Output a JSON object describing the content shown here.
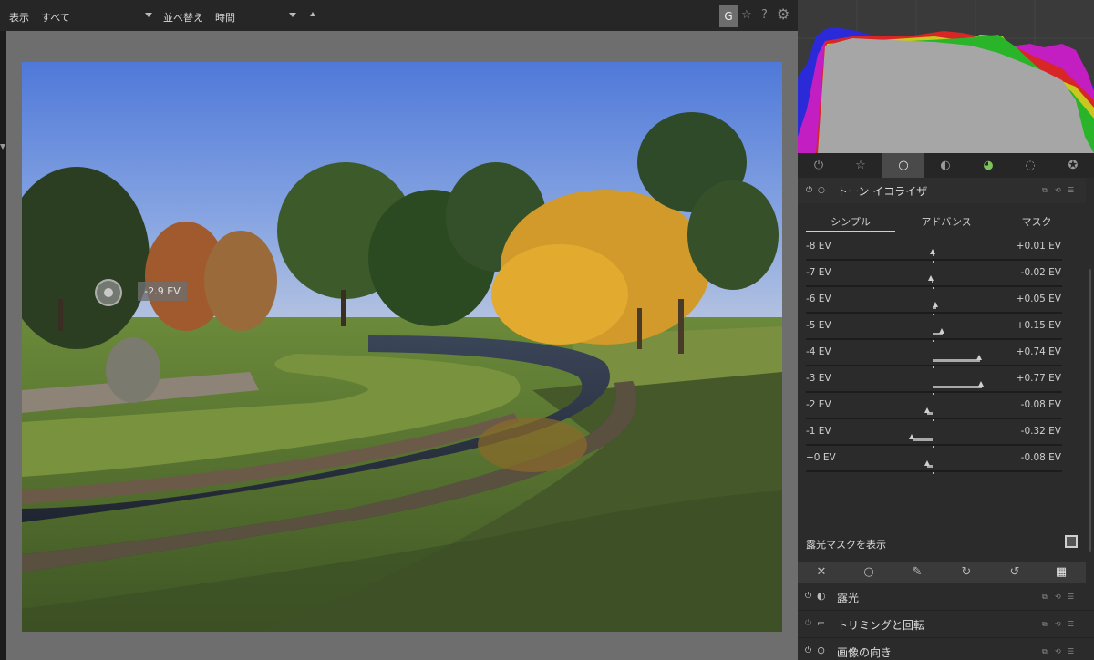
{
  "topbar": {
    "view_label": "表示",
    "view_value": "すべて",
    "sort_label": "並べ替え",
    "sort_value": "時間",
    "g_button": "G",
    "star_icon": "☆",
    "help_icon": "?",
    "settings_icon": "⚙"
  },
  "picker": {
    "readout": "-2.9 EV"
  },
  "module_tabs": [
    "⏻",
    "☆",
    "○",
    "◐",
    "◕",
    "◌",
    "✪"
  ],
  "module": {
    "title": "トーン イコライザ",
    "subtabs": [
      "シンプル",
      "アドバンス",
      "マスク"
    ],
    "active_subtab": 0,
    "sliders": [
      {
        "name": "-8 EV",
        "value": "+0.01 EV",
        "ev": 0.01
      },
      {
        "name": "-7 EV",
        "value": "-0.02 EV",
        "ev": -0.02
      },
      {
        "name": "-6 EV",
        "value": "+0.05 EV",
        "ev": 0.05
      },
      {
        "name": "-5 EV",
        "value": "+0.15 EV",
        "ev": 0.15
      },
      {
        "name": "-4 EV",
        "value": "+0.74 EV",
        "ev": 0.74
      },
      {
        "name": "-3 EV",
        "value": "+0.77 EV",
        "ev": 0.77
      },
      {
        "name": "-2 EV",
        "value": "-0.08 EV",
        "ev": -0.08
      },
      {
        "name": "-1 EV",
        "value": "-0.32 EV",
        "ev": -0.32
      },
      {
        "name": "+0 EV",
        "value": "-0.08 EV",
        "ev": -0.08
      }
    ],
    "mask_label": "露光マスクを表示"
  },
  "blend_icons": [
    "✕",
    "○",
    "✎",
    "↻",
    "↺",
    "▦"
  ],
  "modules_below": [
    {
      "title": "露光",
      "power": "⏻",
      "icon": "◐"
    },
    {
      "title": "トリミングと回転",
      "power": "⏻",
      "icon": "⌐"
    },
    {
      "title": "画像の向き",
      "power": "⏻",
      "icon": "⊙"
    }
  ],
  "colors": {
    "accent": "#cfcfcf",
    "panel_bg": "#2b2b2b",
    "center_bg": "#6e6e6e"
  }
}
